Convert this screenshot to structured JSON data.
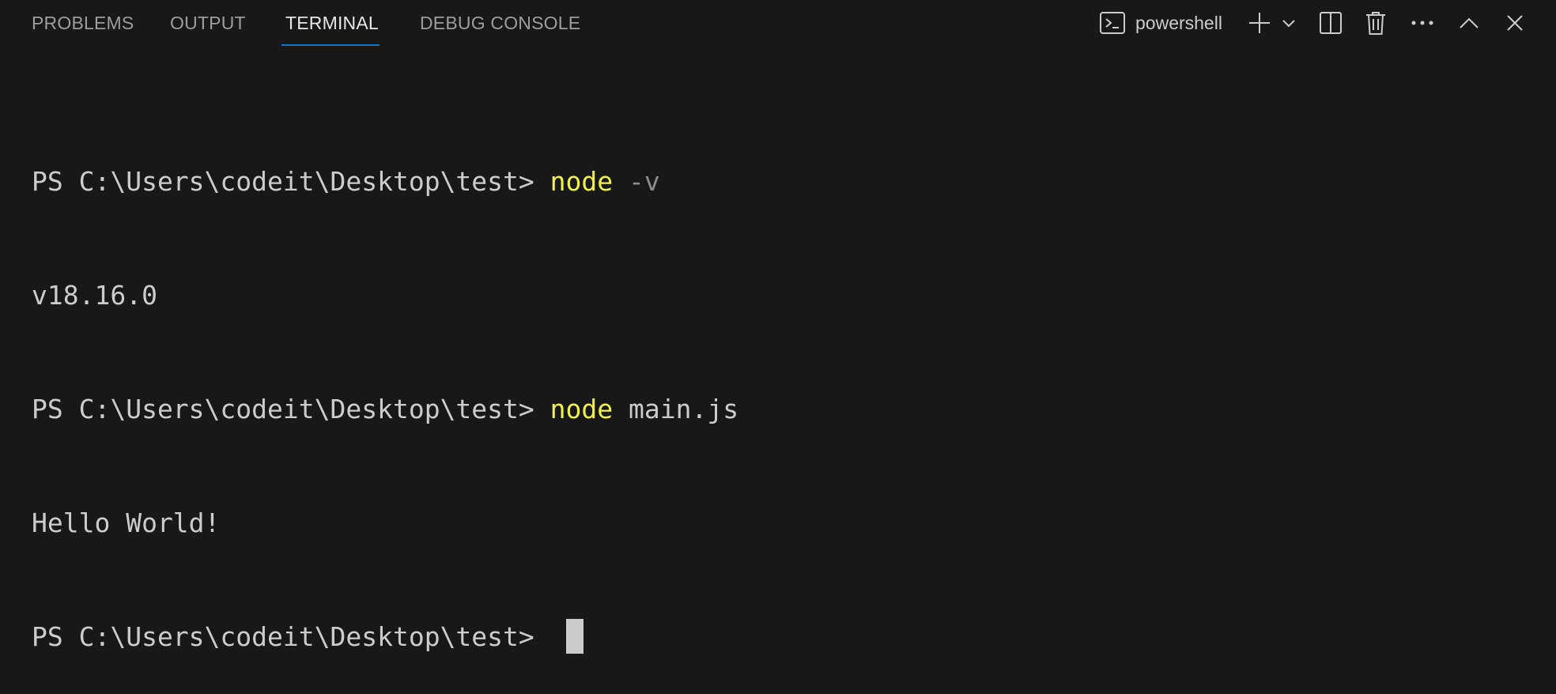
{
  "tabs": [
    {
      "label": "PROBLEMS",
      "active": false
    },
    {
      "label": "OUTPUT",
      "active": false
    },
    {
      "label": "TERMINAL",
      "active": true
    },
    {
      "label": "DEBUG CONSOLE",
      "active": false
    }
  ],
  "toolbar": {
    "profile_label": "powershell",
    "profile_icon": "terminal-icon",
    "new_terminal_icon": "plus-icon",
    "launch_profile_icon": "chevron-down-icon",
    "split_icon": "split-editor-icon",
    "kill_icon": "trash-icon",
    "more_icon": "ellipsis-icon",
    "maximize_icon": "chevron-up-icon",
    "close_icon": "close-icon"
  },
  "terminal": {
    "lines": [
      {
        "prompt": "PS C:\\Users\\codeit\\Desktop\\test> ",
        "command": "node",
        "args": " -v",
        "args_style": "dim"
      },
      {
        "output": "v18.16.0"
      },
      {
        "prompt": "PS C:\\Users\\codeit\\Desktop\\test> ",
        "command": "node",
        "args": " main.js",
        "args_style": "plain"
      },
      {
        "output": "Hello World!"
      },
      {
        "prompt": "PS C:\\Users\\codeit\\Desktop\\test> ",
        "cursor": true
      }
    ]
  },
  "colors": {
    "background": "#181818",
    "accent": "#0078d4",
    "command": "#f1f146",
    "text": "#cccccc",
    "dim_arg": "#8b8b8b"
  }
}
